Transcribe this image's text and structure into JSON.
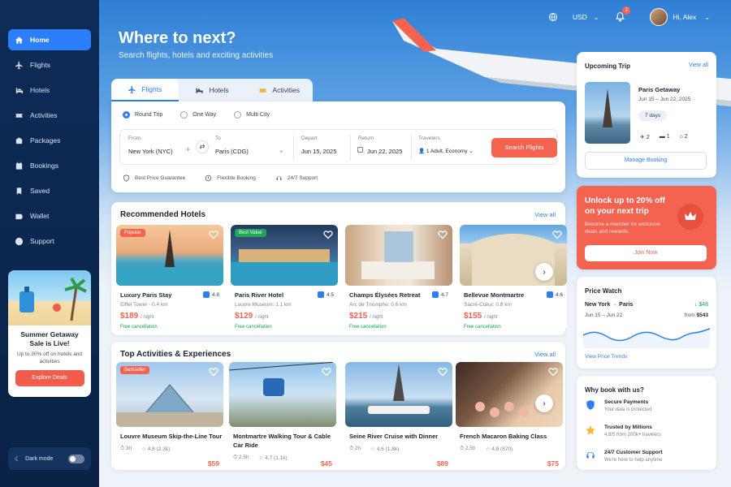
{
  "nav": {
    "items": [
      {
        "label": "Home",
        "active": true
      },
      {
        "label": "Flights"
      },
      {
        "label": "Hotels"
      },
      {
        "label": "Activities"
      },
      {
        "label": "Packages"
      },
      {
        "label": "Bookings"
      },
      {
        "label": "Saved"
      },
      {
        "label": "Wallet"
      },
      {
        "label": "Support"
      }
    ]
  },
  "promo": {
    "title": "Summer Getaway Sale is Live!",
    "subtitle": "Up to 30% off on hotels and activities",
    "button": "Explore Deals"
  },
  "dark_mode": {
    "label": "Dark mode"
  },
  "topbar": {
    "currency": "USD",
    "notification_count": "2",
    "user_greeting": "Hi, Alex"
  },
  "hero": {
    "title": "Where to next?",
    "subtitle": "Search flights, hotels and exciting activities"
  },
  "search": {
    "tabs": [
      "Flights",
      "Hotels",
      "Activities"
    ],
    "trip_types": [
      "Round Trip",
      "One Way",
      "Multi City"
    ],
    "from_label": "From",
    "from_value": "New York (NYC)",
    "to_label": "To",
    "to_value": "Paris (CDG)",
    "depart_label": "Depart",
    "depart_value": "Jun 15, 2025",
    "return_label": "Return",
    "return_value": "Jun 22, 2025",
    "travelers_label": "Travelers",
    "travelers_value": "1 Adult, Economy",
    "button": "Search Flights",
    "features": [
      "Best Price Guarantee",
      "Flexible Booking",
      "24/7 Support"
    ]
  },
  "hotels": {
    "title": "Recommended Hotels",
    "view_all": "View all",
    "items": [
      {
        "name": "Luxury Paris Stay",
        "location": "Eiffel Tower · 0.4 km",
        "rating": "4.8",
        "price": "$189",
        "per": "/ night",
        "badge": "Popular",
        "badge_color": "#f36350",
        "free": "Free cancellation"
      },
      {
        "name": "Paris River Hotel",
        "location": "Louvre Museum: 1.1 km",
        "rating": "4.5",
        "price": "$129",
        "per": "/ night",
        "badge": "Best Value",
        "badge_color": "#22a55a",
        "free": "Free cancellation"
      },
      {
        "name": "Champs Élysées Retreat",
        "location": "Arc de Triomphe: 0.6 km",
        "rating": "4.7",
        "price": "$215",
        "per": "/ night",
        "free": "Free cancellation"
      },
      {
        "name": "Bellevue Montmartre",
        "location": "Sacré-Cœur: 0.8 km",
        "rating": "4.6",
        "price": "$155",
        "per": "/ night",
        "free": "Free cancellation"
      }
    ]
  },
  "activities": {
    "title": "Top Activities & Experiences",
    "view_all": "View all",
    "items": [
      {
        "name": "Louvre Museum Skip-the-Line Tour",
        "duration": "3h",
        "rating": "4.8",
        "reviews": "(2.3k)",
        "price": "$59",
        "badge": "Bestseller"
      },
      {
        "name": "Montmartre Walking Tour & Cable Car Ride",
        "duration": "2.5h",
        "rating": "4.7",
        "reviews": "(1.1k)",
        "price": "$45"
      },
      {
        "name": "Seine River Cruise with Dinner",
        "duration": "2h",
        "rating": "4.6",
        "reviews": "(1.8k)",
        "price": "$89"
      },
      {
        "name": "French Macaron Baking Class",
        "duration": "2.5h",
        "rating": "4.9",
        "reviews": "(870)",
        "price": "$75"
      }
    ]
  },
  "upcoming": {
    "title": "Upcoming Trip",
    "view_all": "View all",
    "trip_name": "Paris Getaway",
    "dates": "Jun 15 – Jun 22, 2025",
    "duration": "7 days",
    "flights": "2",
    "hotels": "1",
    "activities": "2",
    "button": "Manage Booking"
  },
  "unlock": {
    "title": "Unlock up to 20% off on your next trip",
    "subtitle": "Become a member for exclusive deals and rewards.",
    "button": "Join Now"
  },
  "price_watch": {
    "title": "Price Watch",
    "from": "New York",
    "to": "Paris",
    "dates": "Jun 15 – Jun 22",
    "change": "$48",
    "price_prefix": "from",
    "price": "$543",
    "link": "View Price Trends"
  },
  "why": {
    "title": "Why book with us?",
    "items": [
      {
        "title": "Secure Payments",
        "sub": "Your data is protected"
      },
      {
        "title": "Trusted by Millions",
        "sub": "4.8/5 from 200k+ travelers"
      },
      {
        "title": "24/7 Customer Support",
        "sub": "We're here to help anytime"
      }
    ]
  }
}
